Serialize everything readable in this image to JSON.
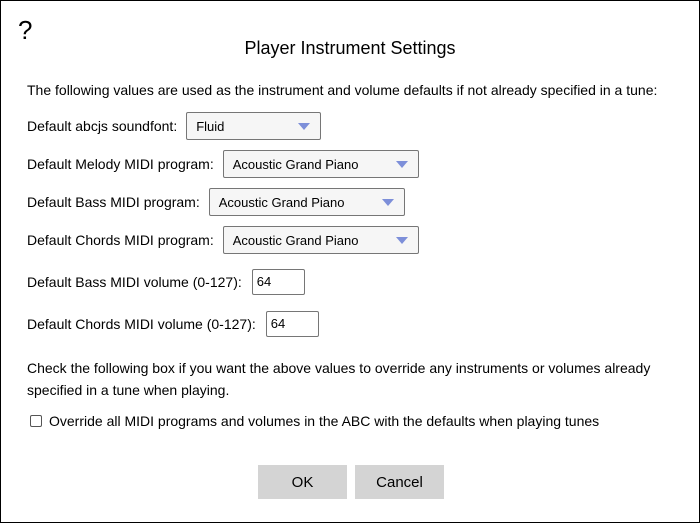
{
  "dialog": {
    "help_glyph": "?",
    "title": "Player Instrument Settings",
    "intro": "The following values are used as the instrument and volume defaults if not already specified in a tune:",
    "soundfont": {
      "label": "Default abcjs soundfont:",
      "value": "Fluid"
    },
    "melody": {
      "label": "Default Melody MIDI program:",
      "value": "Acoustic Grand Piano"
    },
    "bass": {
      "label": "Default Bass MIDI program:",
      "value": "Acoustic Grand Piano"
    },
    "chords": {
      "label": "Default Chords MIDI program:",
      "value": "Acoustic Grand Piano"
    },
    "bass_volume": {
      "label": "Default Bass MIDI volume (0-127):",
      "value": "64"
    },
    "chords_volume": {
      "label": "Default Chords MIDI volume (0-127):",
      "value": "64"
    },
    "override_note": "Check the following box if you want the above values to override any instruments or volumes already specified in a tune when playing.",
    "override_checkbox": {
      "label": "Override all MIDI programs and volumes in the ABC with the defaults when playing tunes",
      "checked": false
    },
    "ok_label": "OK",
    "cancel_label": "Cancel",
    "dropdown_arrow_color": "#7d8fd9"
  }
}
